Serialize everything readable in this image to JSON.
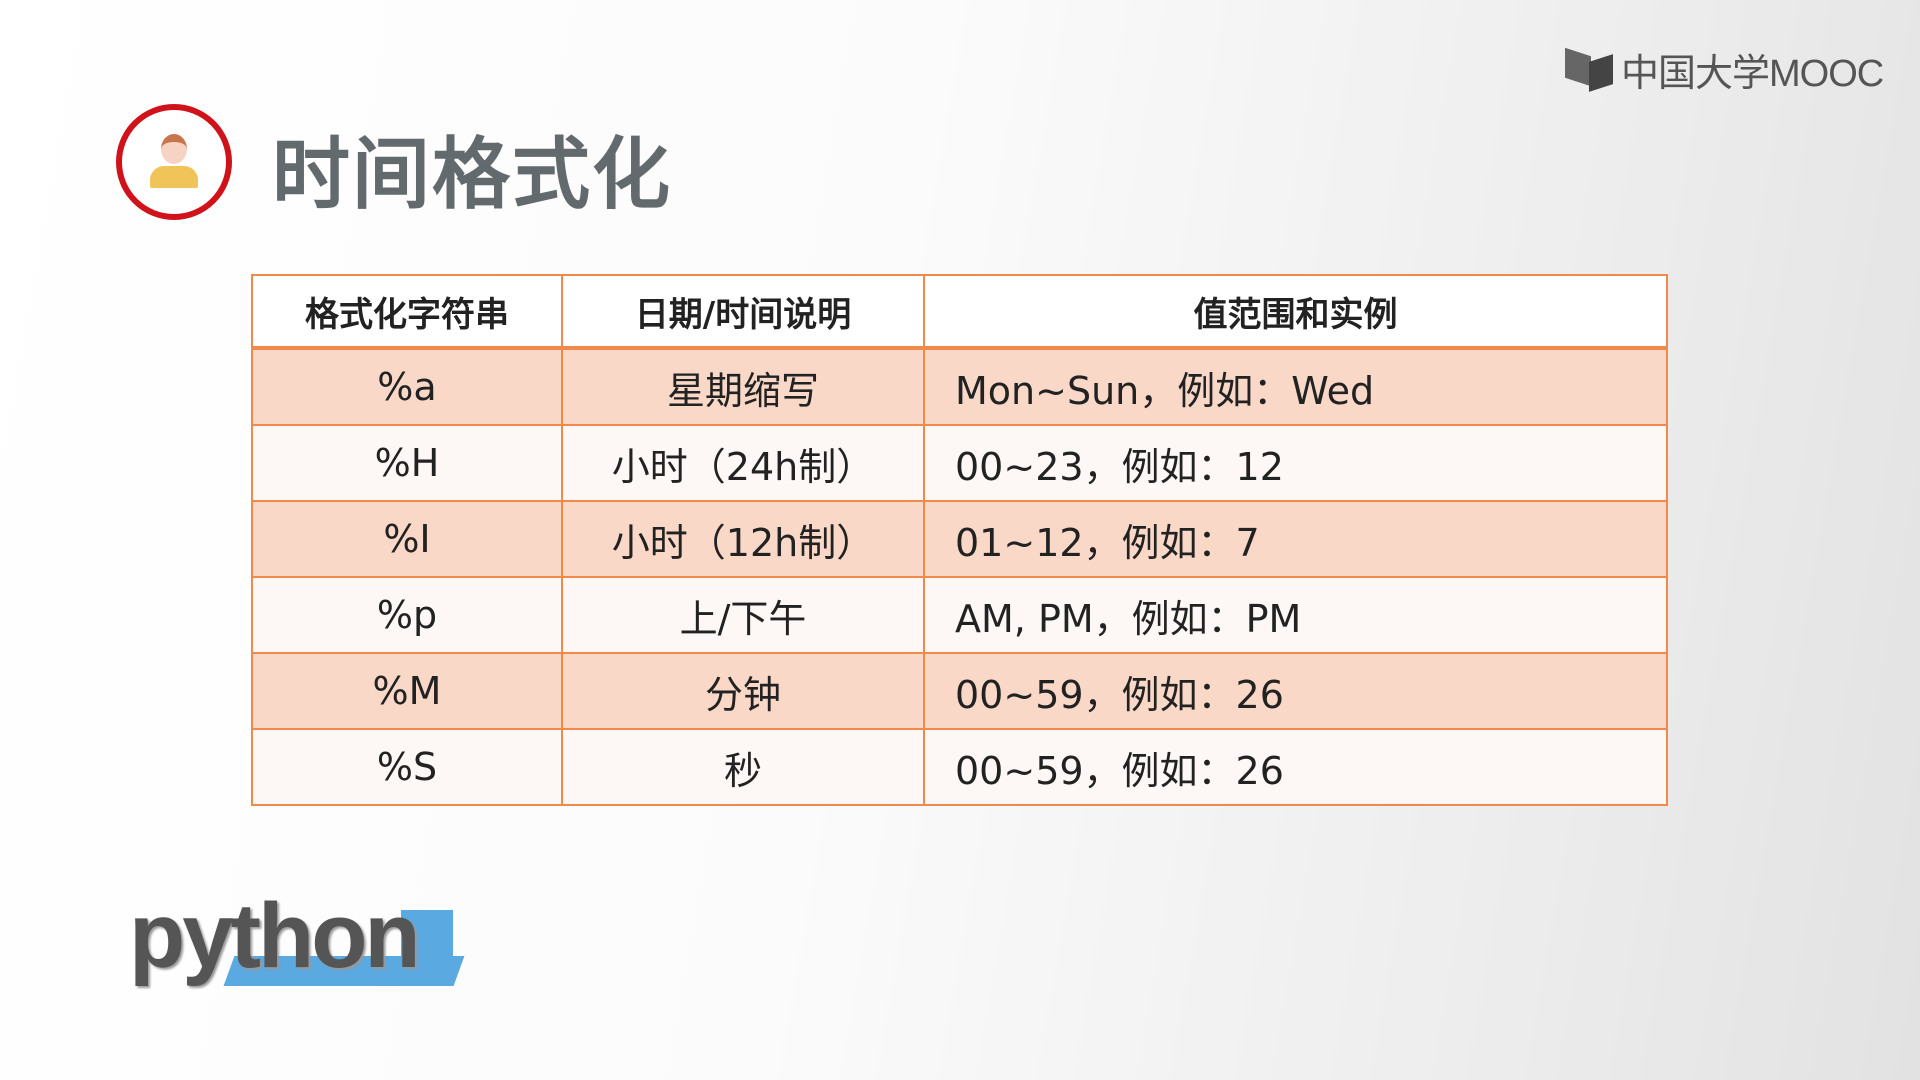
{
  "logo": {
    "text": "中国大学MOOC"
  },
  "title": "时间格式化",
  "python_logo": "python",
  "table": {
    "headers": [
      "格式化字符串",
      "日期/时间说明",
      "值范围和实例"
    ],
    "rows": [
      [
        "%a",
        "星期缩写",
        "Mon~Sun，例如：Wed"
      ],
      [
        "%H",
        "小时（24h制）",
        "00~23，例如：12"
      ],
      [
        "%I",
        "小时（12h制）",
        "01~12，例如：7"
      ],
      [
        "%p",
        "上/下午",
        "AM, PM，例如：PM"
      ],
      [
        "%M",
        "分钟",
        "00~59，例如：26"
      ],
      [
        "%S",
        "秒",
        "00~59，例如：26"
      ]
    ]
  },
  "colors": {
    "border": "#f08a4b",
    "row_highlight": "#f9d8c8",
    "avatar_ring": "#d0121b"
  }
}
